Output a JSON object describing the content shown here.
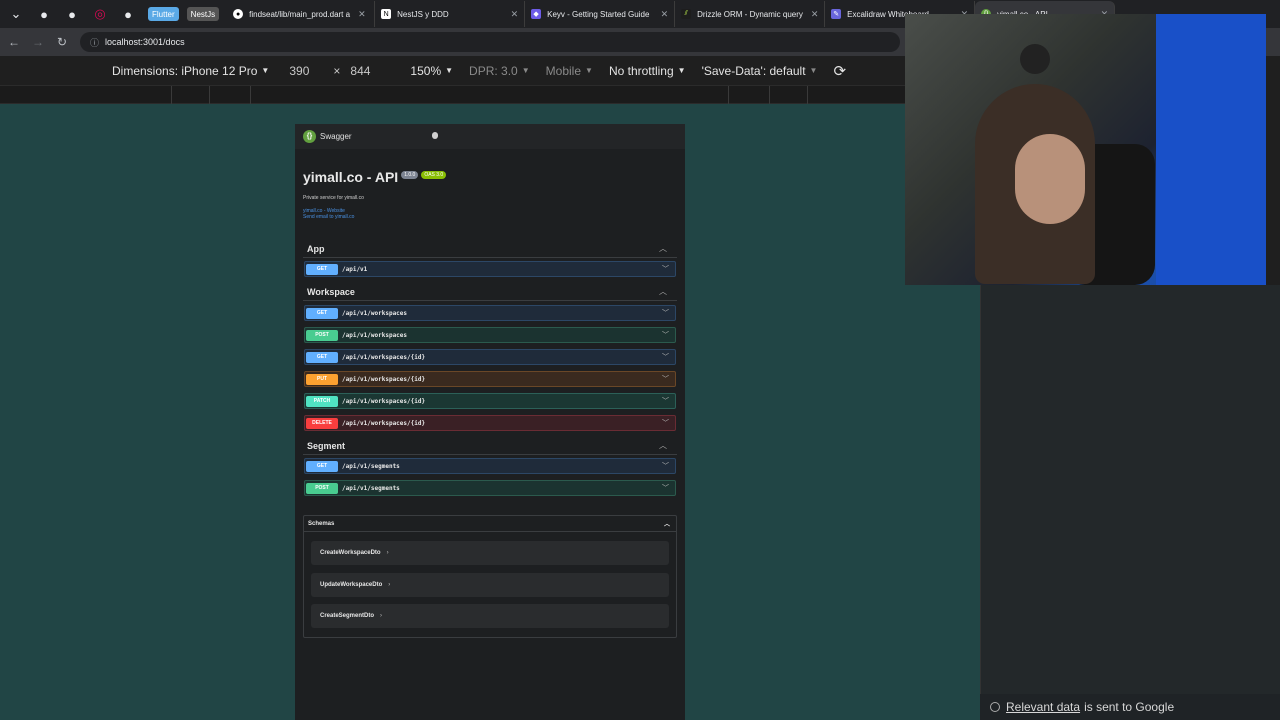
{
  "tabs": [
    {
      "label": "Flutter",
      "kind": "chip",
      "color": "#5aa9e6"
    },
    {
      "label": "NestJs",
      "kind": "chip",
      "color": "#555555"
    },
    {
      "label": "findseat/lib/main_prod.dart a",
      "icon": "github-icon"
    },
    {
      "label": "NestJS y DDD",
      "icon": "notion-icon"
    },
    {
      "label": "Keyv - Getting Started Guide",
      "icon": "keyv-icon"
    },
    {
      "label": "Drizzle ORM - Dynamic query",
      "icon": "drizzle-icon"
    },
    {
      "label": "Excalidraw Whiteboard",
      "icon": "excalidraw-icon"
    },
    {
      "label": "yimall.co - API",
      "icon": "swagger-icon"
    }
  ],
  "address": {
    "url": "localhost:3001/docs"
  },
  "devtools": {
    "dimensions_label": "Dimensions: iPhone 12 Pro",
    "width": "390",
    "times": "×",
    "height": "844",
    "zoom": "150%",
    "dpr": "DPR: 3.0",
    "mobile": "Mobile",
    "throttling": "No throttling",
    "save_data": "'Save-Data': default"
  },
  "swagger": {
    "brand": "Swagger",
    "title": "yimall.co - API",
    "version": "1.0.0",
    "oas": "OAS 3.0",
    "description": "Private service for yimall.co",
    "link_website": "yimall.co - Website",
    "link_email": "Send email to yimall.co",
    "tags": [
      {
        "name": "App",
        "ops": [
          {
            "method": "GET",
            "path": "/api/v1"
          }
        ]
      },
      {
        "name": "Workspace",
        "ops": [
          {
            "method": "GET",
            "path": "/api/v1/workspaces"
          },
          {
            "method": "POST",
            "path": "/api/v1/workspaces"
          },
          {
            "method": "GET",
            "path": "/api/v1/workspaces/{id}"
          },
          {
            "method": "PUT",
            "path": "/api/v1/workspaces/{id}"
          },
          {
            "method": "PATCH",
            "path": "/api/v1/workspaces/{id}"
          },
          {
            "method": "DELETE",
            "path": "/api/v1/workspaces/{id}"
          }
        ]
      },
      {
        "name": "Segment",
        "ops": [
          {
            "method": "GET",
            "path": "/api/v1/segments"
          },
          {
            "method": "POST",
            "path": "/api/v1/segments"
          }
        ]
      }
    ],
    "schemas_title": "Schemas",
    "schemas": [
      "CreateWorkspaceDto",
      "UpdateWorkspaceDto",
      "CreateSegmentDto"
    ]
  },
  "footer": {
    "link": "Relevant data",
    "text": "is sent to Google"
  }
}
